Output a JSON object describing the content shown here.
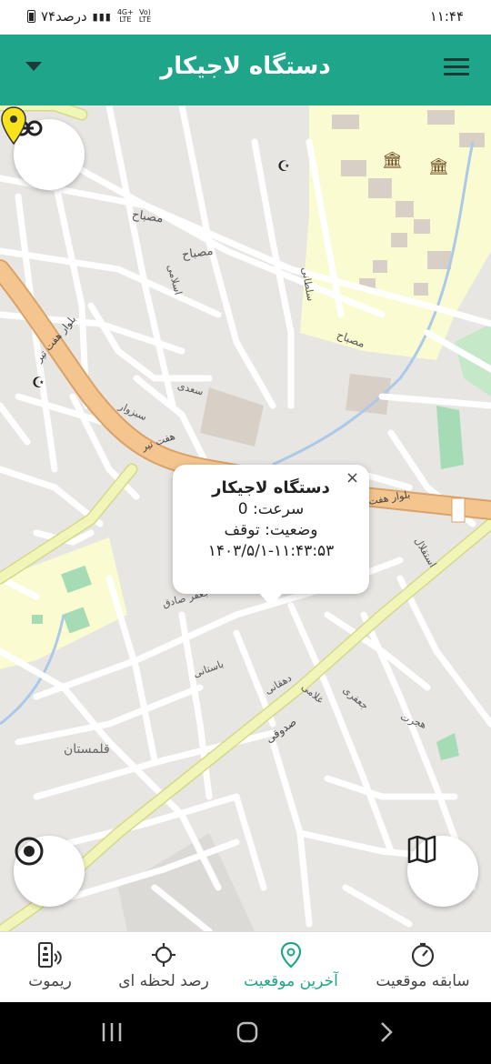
{
  "status_bar": {
    "time": "۱۱:۴۴",
    "battery": "۷۴درصد",
    "network_top": "4G+",
    "network_bottom": "LTE",
    "volte_label": "Vo)"
  },
  "header": {
    "title": "دستگاه لاجیکار"
  },
  "map": {
    "popup": {
      "title": "دستگاه لاجیکار",
      "speed_label": "سرعت:",
      "speed_value": "0",
      "status_label": "وضعیت:",
      "status_value": "توقف",
      "timestamp": "۱۴۰۳/۵/۱-۱۱:۴۳:۵۳",
      "close": "×"
    },
    "marker_color": "#f7e21b",
    "labels": {
      "mesbah": "مصباح",
      "mesbah2": "مصباح",
      "mesbah3": "مصباح",
      "boulevard": "بلوار هفت تیر",
      "boulevard2": "هفت تیر",
      "qalamestan": "قلمستان",
      "sadoughi": "صدوقی",
      "haft_tir_east": "بلوار هفت",
      "sabzevar": "سبزوار",
      "dehghani": "دهقانی",
      "baseli": "باستانی",
      "gholami": "غلامی",
      "jafari": "جعفری",
      "hejrat": "هجرت",
      "esteghlal": "استقلال",
      "saadi": "سعدی",
      "sotani": "سلطانی",
      "eslami": "اسلامی",
      "sadeghi": "جعفر صادق"
    }
  },
  "buttons": {
    "link": "link-icon",
    "gps": "locate-icon",
    "layers": "map-layers-icon"
  },
  "bottom_nav": {
    "items": [
      {
        "label": "سابقه موقعیت",
        "icon": "history-icon"
      },
      {
        "label": "آخرین موقعیت",
        "icon": "location-pin-icon"
      },
      {
        "label": "رصد لحظه ای",
        "icon": "crosshair-icon"
      },
      {
        "label": "ریموت",
        "icon": "remote-icon"
      }
    ],
    "active_color": "#1fa58a"
  },
  "colors": {
    "primary": "#1fa58a",
    "boulevard": "#f4c58f",
    "secondary_road": "#f2f5b8",
    "park": "#a6dcb5",
    "residential": "#fafbd0"
  }
}
